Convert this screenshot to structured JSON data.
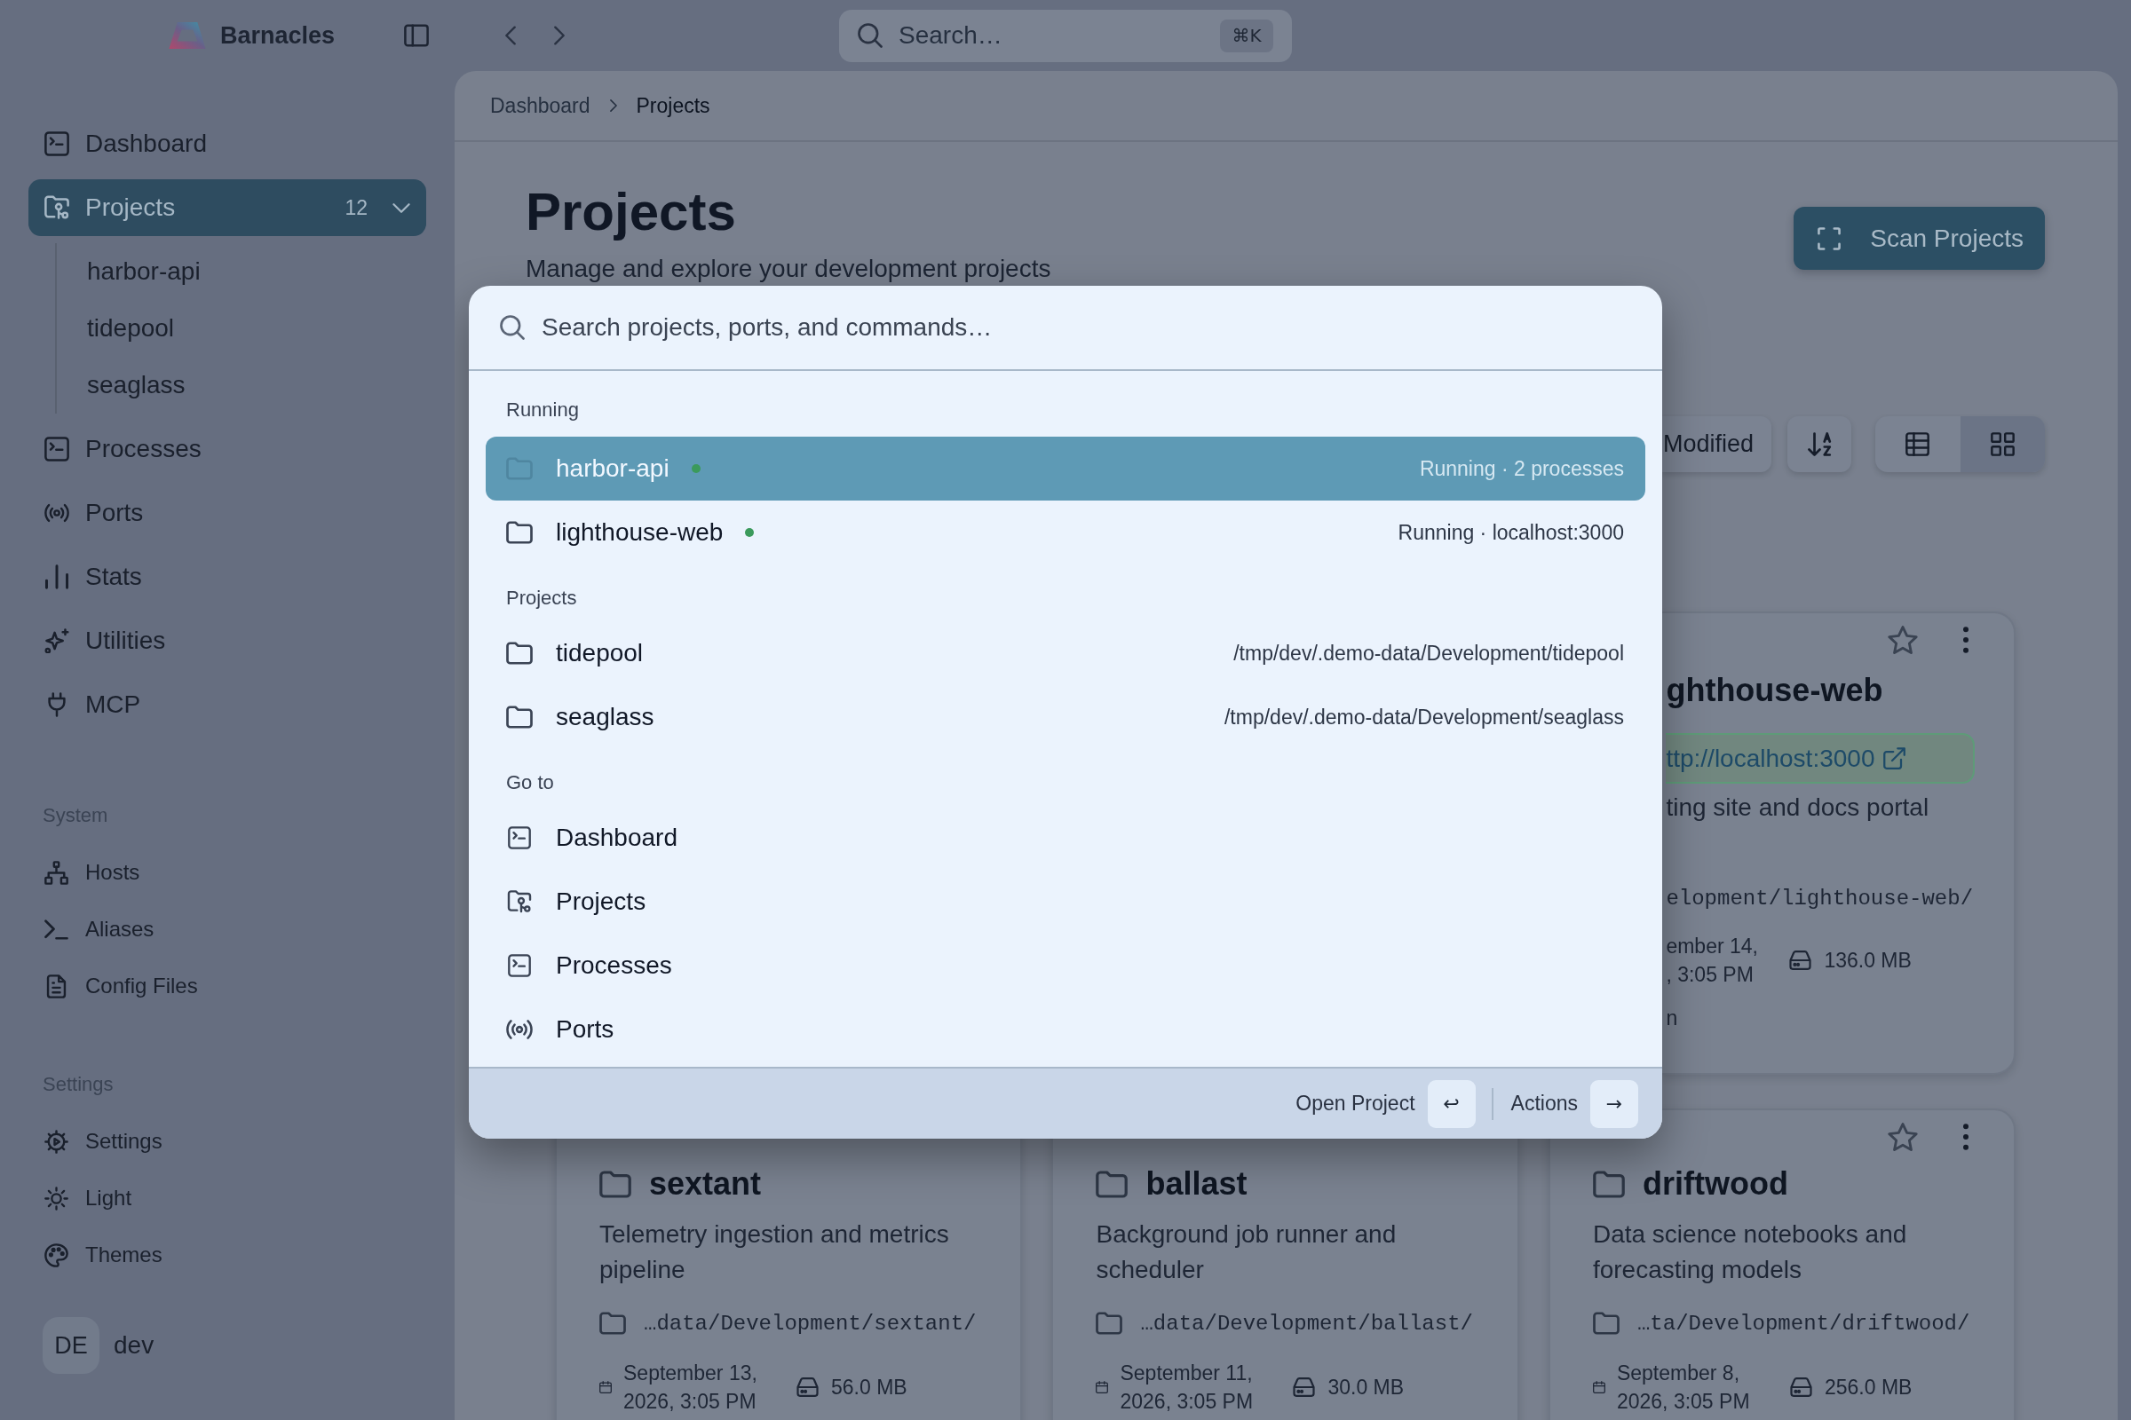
{
  "app": {
    "name": "Barnacles"
  },
  "top_search": {
    "placeholder": "Search…",
    "shortcut": "⌘K"
  },
  "sidebar": {
    "sections": [
      {
        "items": [
          {
            "label": "Dashboard",
            "selected": false
          },
          {
            "label": "Projects",
            "selected": true,
            "count": "12",
            "expanded": true,
            "children": [
              {
                "label": "harbor-api",
                "selected": false
              },
              {
                "label": "tidepool",
                "selected": false
              },
              {
                "label": "seaglass",
                "selected": false
              }
            ]
          },
          {
            "label": "Processes",
            "selected": false
          },
          {
            "label": "Ports",
            "selected": false
          },
          {
            "label": "Stats",
            "selected": false
          },
          {
            "label": "Utilities",
            "selected": false
          },
          {
            "label": "MCP",
            "selected": false
          }
        ]
      },
      {
        "title": "System",
        "items": [
          {
            "label": "Hosts",
            "selected": false
          },
          {
            "label": "Aliases",
            "selected": false
          },
          {
            "label": "Config Files",
            "selected": false
          }
        ]
      },
      {
        "title": "Settings",
        "items": [
          {
            "label": "Settings",
            "selected": false
          },
          {
            "label": "Light",
            "selected": false
          },
          {
            "label": "Themes",
            "selected": false
          }
        ]
      }
    ],
    "user": {
      "initials": "DE",
      "name": "dev"
    }
  },
  "breadcrumb": [
    {
      "label": "Dashboard",
      "current": false
    },
    {
      "label": "Projects",
      "current": true
    }
  ],
  "header": {
    "title": "Projects",
    "subtitle": "Manage and explore your development projects",
    "action": "Scan Projects"
  },
  "toolbar": {
    "sort_field": "Modified",
    "views": [
      {
        "selected": false
      },
      {
        "selected": true
      }
    ]
  },
  "projects": [
    {
      "kind": "clipped",
      "name": "ghthouse-web",
      "starred": false,
      "url": "ttp://localhost:3000",
      "description": "ting site and docs portal",
      "path": "elopment/lighthouse-web/",
      "modified": [
        "ember 14,",
        ", 3:05 PM"
      ],
      "size": "136.0 MB",
      "trailing_text": "n"
    },
    {
      "kind": "card",
      "name": "sextant",
      "description": "Telemetry ingestion and metrics pipeline",
      "path": "…data/Development/sextant/",
      "modified": [
        "September 13,",
        "2026, 3:05 PM"
      ],
      "size": "56.0 MB"
    },
    {
      "kind": "card",
      "name": "ballast",
      "description": "Background job runner and scheduler",
      "path": "…data/Development/ballast/",
      "modified": [
        "September 11,",
        "2026, 3:05 PM"
      ],
      "size": "30.0 MB"
    },
    {
      "kind": "card",
      "name": "driftwood",
      "starred": false,
      "description": "Data science notebooks and forecasting models",
      "path": "…ta/Development/driftwood/",
      "modified": [
        "September 8,",
        "2026, 3:05 PM"
      ],
      "size": "256.0 MB"
    }
  ],
  "command_palette": {
    "placeholder": "Search projects, ports, and commands…",
    "groups": [
      {
        "title": "Running",
        "items": [
          {
            "label": "harbor-api",
            "running": true,
            "detail": "Running · 2 processes",
            "selected": true
          },
          {
            "label": "lighthouse-web",
            "running": true,
            "detail": "Running · localhost:3000",
            "selected": false
          }
        ]
      },
      {
        "title": "Projects",
        "items": [
          {
            "label": "tidepool",
            "running": false,
            "detail": "/tmp/dev/.demo-data/Development/tidepool",
            "selected": false
          },
          {
            "label": "seaglass",
            "running": false,
            "detail": "/tmp/dev/.demo-data/Development/seaglass",
            "selected": false
          }
        ]
      },
      {
        "title": "Go to",
        "items": [
          {
            "label": "Dashboard",
            "selected": false
          },
          {
            "label": "Projects",
            "selected": false
          },
          {
            "label": "Processes",
            "selected": false
          },
          {
            "label": "Ports",
            "selected": false
          }
        ]
      }
    ],
    "footer": [
      {
        "label": "Open Project",
        "key": "↩"
      },
      {
        "label": "Actions",
        "key": "→"
      }
    ]
  }
}
